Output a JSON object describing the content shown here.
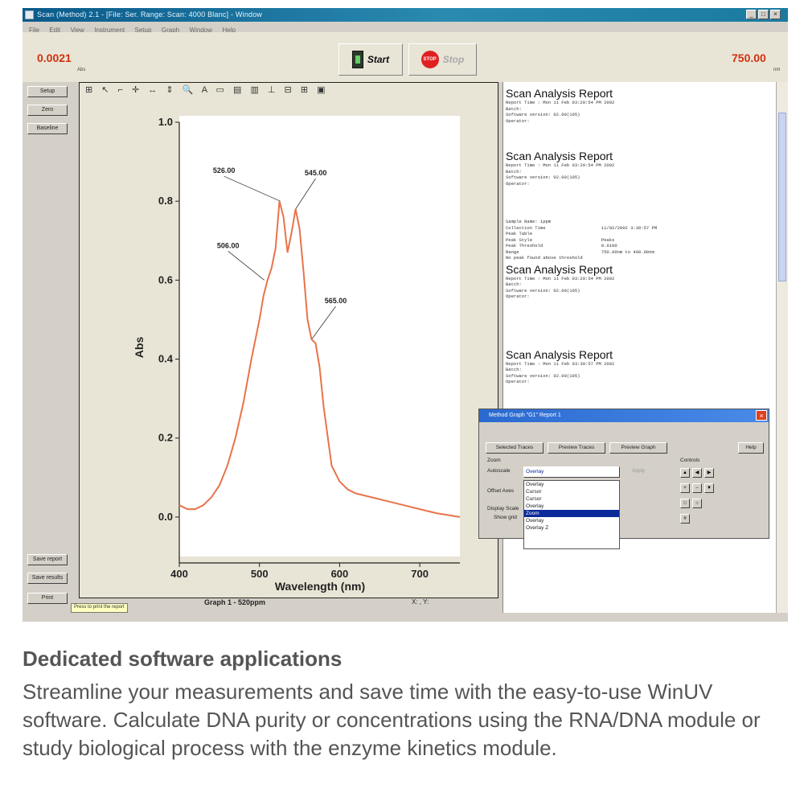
{
  "window": {
    "title": "Scan (Method) 2.1 - [File: Ser. Range: Scan: 4000 Blanc] - Window",
    "menu": [
      "File",
      "Edit",
      "View",
      "Instrument",
      "Setup",
      "Graph",
      "Window",
      "Help"
    ]
  },
  "toolbar": {
    "left_value": "0.0021",
    "left_unit": "Abs",
    "right_value": "750.00",
    "right_unit": "nm",
    "start_label": "Start",
    "stop_label": "Stop",
    "stop_icon_label": "STOP"
  },
  "sidebar": {
    "top_buttons": [
      "Setup",
      "Zero",
      "Baseline"
    ],
    "bottom_buttons": [
      "Save report",
      "Save results",
      "Print"
    ]
  },
  "plot": {
    "tools": "⊞ ↖ ⌐ ✛ ↔ ⇕ 🔍 A ▭ ▤ ▥ ⊥ ⊟ ⊞ ▣",
    "caption": "Graph 1 - 520ppm",
    "coords": "X: , Y:",
    "hint": "Press to print the report"
  },
  "chart_data": {
    "type": "line",
    "xlabel": "Wavelength (nm)",
    "ylabel": "Abs",
    "xlim": [
      400,
      750
    ],
    "ylim": [
      -0.1,
      1.0
    ],
    "x_ticks": [
      "400",
      "500",
      "600",
      "700"
    ],
    "y_ticks": [
      "0.0",
      "0.2",
      "0.4",
      "0.6",
      "0.8",
      "1.0"
    ],
    "series": [
      {
        "color": "#e8734a",
        "x": [
          400,
          410,
          420,
          430,
          440,
          450,
          460,
          470,
          480,
          490,
          500,
          505,
          510,
          515,
          520,
          525,
          530,
          535,
          540,
          545,
          550,
          555,
          560,
          565,
          570,
          575,
          580,
          590,
          600,
          610,
          620,
          640,
          660,
          680,
          700,
          720,
          750
        ],
        "y": [
          0.03,
          0.02,
          0.02,
          0.03,
          0.05,
          0.08,
          0.13,
          0.2,
          0.29,
          0.4,
          0.5,
          0.56,
          0.6,
          0.63,
          0.68,
          0.8,
          0.76,
          0.67,
          0.72,
          0.78,
          0.73,
          0.62,
          0.5,
          0.45,
          0.44,
          0.38,
          0.28,
          0.13,
          0.09,
          0.07,
          0.06,
          0.05,
          0.04,
          0.03,
          0.02,
          0.01,
          0.0
        ]
      }
    ],
    "annotations": [
      {
        "label": "506.00",
        "x": 506,
        "y": 0.6
      },
      {
        "label": "526.00",
        "x": 526,
        "y": 0.8
      },
      {
        "label": "545.00",
        "x": 545,
        "y": 0.78
      },
      {
        "label": "565.00",
        "x": 565,
        "y": 0.45
      }
    ]
  },
  "report": {
    "blocks": [
      {
        "heading": "Scan Analysis Report",
        "lines": [
          "Report Time : Mon 11 Feb 03:20:54 PM 2002",
          "Batch:",
          "Software version: 02.00(105)",
          "Operator:"
        ]
      },
      {
        "heading": "Scan Analysis Report",
        "lines": [
          "Report Time : Mon 11 Feb 03:20:54 PM 2002",
          "Batch:",
          "Software version: 02.00(105)",
          "Operator:"
        ]
      },
      {
        "heading": "",
        "lines": [
          "Sample Name: 1ppm",
          "Collection Time                     11/02/2002 3:30:57 PM",
          "",
          "",
          "Peak Table",
          "Peak Style                          Peaks",
          "Peak Threshold                      0.0100",
          "Range                               750.00nm to 400.00nm",
          "",
          "No peak found above threshold"
        ]
      },
      {
        "heading": "Scan Analysis Report",
        "lines": [
          "Report Time : Mon 11 Feb 03:20:54 PM 2002",
          "Batch:",
          "Software version: 02.00(105)",
          "Operator:"
        ]
      },
      {
        "heading": "Scan Analysis Report",
        "lines": [
          "Report Time : Mon 11 Feb 03:30:57 PM 2002",
          "Batch:",
          "Software version: 02.00(105)",
          "Operator:"
        ]
      }
    ]
  },
  "dialog": {
    "title": "Method Graph \"G1\" Report 1",
    "buttons": [
      "Selected Traces",
      "Preview Traces",
      "Preview Graph"
    ],
    "help_label": "Help",
    "zoom_label": "Zoom",
    "autoscale_label": "Autoscale",
    "offset_label": "Offset Axes",
    "display_label": "Display Scale",
    "show_label": "Show grid",
    "selected_value": "Overlay",
    "options": [
      "Overlay",
      "Cursor",
      "Cursor",
      "Overlay",
      "Zoom",
      "Overlay",
      "Overlay Z"
    ],
    "selected_option_index": 4,
    "apply_label": "Apply",
    "controls_label": "Controls"
  },
  "article": {
    "heading": "Dedicated software applications",
    "body": "Streamline your measurements and save time with the easy-to-use WinUV software. Calculate DNA purity or concentrations using the RNA/DNA module or study biological process with the enzyme kinetics module."
  },
  "colors": {
    "trace": "#e8734a",
    "readout": "#d03010",
    "title_bar": "#0a5a8a",
    "text_gray": "#555555"
  }
}
